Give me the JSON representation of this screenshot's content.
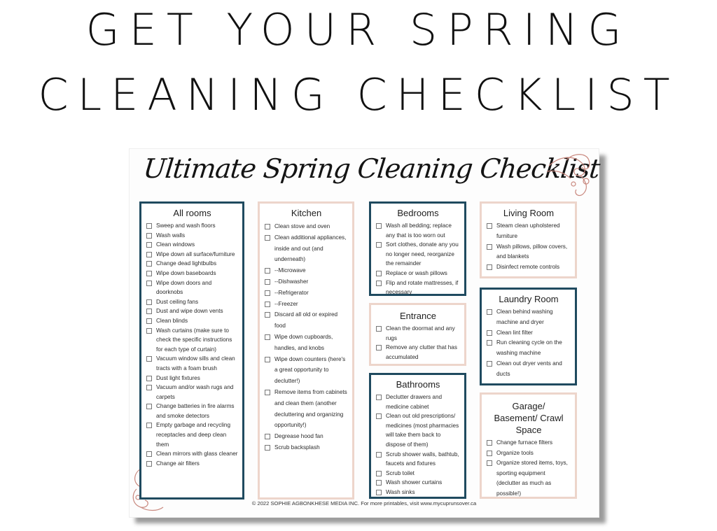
{
  "headline": {
    "line1": "GET YOUR SPRING",
    "line2": "CLEANING CHECKLIST"
  },
  "sheet": {
    "title": "Ultimate Spring Cleaning Checklist",
    "footer": "© 2022 SOPHIE AGBONKHESE MEDIA INC. For more printables, visit www.mycuprunsover.ca",
    "colors": {
      "navy_border": "#1f4a5f",
      "pink_border": "#edd5cb",
      "flourish": "#c9897f"
    },
    "sections": {
      "all_rooms": {
        "title": "All rooms",
        "items": [
          "Sweep and wash floors",
          "Wash walls",
          "Clean windows",
          "Wipe down all surface/furniture",
          "Change dead lightbulbs",
          "Wipe down baseboards",
          "Wipe down doors and doorknobs",
          "Dust ceiling fans",
          "Dust and wipe down vents",
          "Clean blinds",
          "Wash curtains (make sure to check the specific instructions for each type of curtain)",
          "Vacuum window sills and clean tracts with a foam brush",
          "Dust light fixtures",
          "Vacuum and/or wash rugs and carpets",
          "Change batteries in fire alarms and smoke detectors",
          "Empty garbage and recycling receptacles and deep clean them",
          "Clean mirrors with glass cleaner",
          "Change air filters"
        ]
      },
      "kitchen": {
        "title": "Kitchen",
        "items": [
          "Clean stove and oven",
          "Clean additional appliances, inside and out (and underneath)",
          "--Microwave",
          "--Dishwasher",
          "--Refrigerator",
          "--Freezer",
          "Discard all old or expired food",
          "Wipe down cupboards, handles, and knobs",
          "Wipe down counters (here's a great opportunity to declutter!)",
          "Remove items from cabinets and clean them (another decluttering and organizing opportunity!)",
          "Degrease hood fan",
          "Scrub backsplash"
        ]
      },
      "bedrooms": {
        "title": "Bedrooms",
        "items": [
          "Wash all bedding; replace any that is too worn out",
          "Sort clothes, donate any you no longer need, reorganize the remainder",
          "Replace or wash pillows",
          "Flip and rotate mattresses, if necessary"
        ]
      },
      "entrance": {
        "title": "Entrance",
        "items": [
          "Clean the doormat and any rugs",
          "Remove any clutter that has accumulated"
        ]
      },
      "bathrooms": {
        "title": "Bathrooms",
        "items": [
          "Declutter drawers and medicine cabinet",
          "Clean out old prescriptions/ medicines (most pharmacies will take them back to dispose of them)",
          "Scrub shower walls, bathtub, faucets and fixtures",
          "Scrub toilet",
          "Wash shower curtains",
          "Wash sinks"
        ]
      },
      "living_room": {
        "title": "Living Room",
        "items": [
          "Steam clean upholstered furniture",
          "Wash pillows, pillow covers, and blankets",
          "Disinfect remote controls"
        ]
      },
      "laundry_room": {
        "title": "Laundry Room",
        "items": [
          "Clean behind washing machine and dryer",
          "Clean lint filter",
          "Run cleaning cycle on the washing machine",
          "Clean out dryer vents and ducts"
        ]
      },
      "garage": {
        "title": "Garage/ Basement/ Crawl Space",
        "items": [
          "Change furnace filters",
          "Organize tools",
          "Organize stored items, toys, sporting equipment (declutter as much as possible!)"
        ]
      }
    }
  }
}
